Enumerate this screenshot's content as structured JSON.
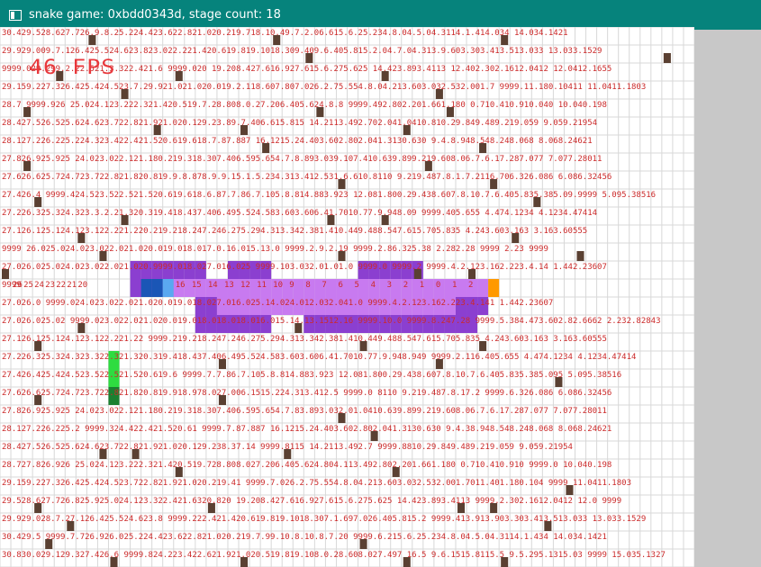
{
  "window": {
    "title": "snake game: 0xbdd0343d, stage count: 18",
    "icon": "window-app-icon"
  },
  "overlay": {
    "fps": "46 FPS"
  },
  "colors": {
    "background": "#ffffff",
    "grid": "#d8d8d8",
    "number_text": "#cc2a2a",
    "obstacle": "#5a4032",
    "path_dark": "#8b3fd0",
    "path_light": "#c87af0",
    "snake_head": "#ff9900",
    "snake_body": "#1a56b6",
    "food_bright": "#2edc40",
    "food_dark": "#1a8030"
  },
  "board": {
    "cols": 64,
    "rows": 30,
    "snake_row": 14,
    "snake_row_numbers": [
      "9999",
      "26",
      "25",
      "24",
      "23",
      "22",
      "21",
      "20",
      "",
      "",
      "",
      "",
      "",
      "",
      "",
      "",
      "",
      "",
      "",
      "",
      "",
      "",
      "",
      "",
      "",
      "",
      "",
      "",
      "",
      "",
      "",
      "",
      "",
      "",
      "",
      "",
      "",
      "",
      "",
      "",
      "",
      "",
      "",
      "",
      "",
      "",
      "",
      "",
      "",
      "",
      "",
      "",
      "",
      "",
      "",
      "",
      "",
      "",
      "",
      "",
      "",
      "",
      "",
      ""
    ],
    "snake_path_labels": [
      "16",
      "15",
      "14",
      "13",
      "12",
      "11",
      "10",
      "9",
      "8",
      "7",
      "6",
      "5",
      "4",
      "3",
      "2",
      "1",
      "0",
      "1",
      "2"
    ],
    "row_text": [
      "30.429.528.627.726.9.8.25.224.423.622.821.020.219.718.10.49.7.2.06.615.6.25.234.8.04.5.04.3114.1.414.034 14.034.1421",
      "29.929.009.7.126.425.524.623.823.022.221.420.619.819.1018.309.409.6.405.815.2.04.7.04.313.9.603.303.413.513.033 13.033.1529",
      "9999.029.299.2.22.521.3.322.421.6 9999.020 19.208.427.616.927.615.6.275.625 14.423.893.4113 12.402.302.1612.0412 12.0412.1655",
      "29.159.227.326.425.424.523.7.29.921.021.020.019.2.118.607.807.026.2.75.554.8.04.213.603.032.532.001.7 9999.11.180.10411 11.0411.1803",
      "28.7 9999.926 25.024.123.222.321.420.519.7.28.808.0.27.206.405.624.8.8 9999.492.802.201.661.180 0.710.410.910.040 10.040.198",
      "28.427.526.525.624.623.722.821.921.020.129.23.89.7.406.615.815 14.2113.492.702.041.0410.810.29.849.489.219.059 9.059.21954",
      "28.127.226.225.224.323.422.421.520.619.618.7.87.887 16.1215.24.403.602.802.041.3130.630 9.4.8.948.548.248.068 8.068.24621",
      "27.826.925.925 24.023.022.121.180.219.318.307.406.595.654.7.8.893.039.107.410.639.899.219.608.06.7.6.17.287.077 7.077.28011",
      "27.626.625.724.723.722.821.820.819.9.8.878.9.9.15.1.5.234.313.412.531.6.610.8110 9.219.487.8.1.7.2116.706.326.086 6.086.32456",
      "27.426.4 9999.424.523.522.521.520.619.618.6.87.7.86.7.105.8.814.883.923 12.081.800.29.438.607.8.10.7.6.405.835.385.09.9999 5.095.38516",
      "27.226.325.324.323.3.2.21.320.319.418.437.406.495.524.583.603.606.41.7010.77.9.948.09 9999.405.655 4.474.1234 4.1234.47414",
      "27.126.125.124.123.122.221.220.219.218.247.246.275.294.313.342.381.410.449.488.547.615.705.835 4.243.603.163 3.163.60555",
      "9999 26.025.024.023.022.021.020.019.018.017.0.16.015.13.0 9999.2.9.2.19 9999.2.86.325.38 2.282.28 9999 2.23 9999",
      "27.026.025.024.023.022.021.020.9999.018.027.016.025 9999.103.032.01.01.0 9999.0 9999.2 9999.4.2.123.162.223.4.14 1.442.23607",
      "",
      "27.026.0 9999.024.023.022.021.020.019.018.027.016.025.14.024.012.032.041.0 9999.4.2.123.162.223.4.141 1.442.23607",
      "27.026.025.02 9999.023.022.021.020.019.018.018.018.016.015.14.13.1512.16 9999.10.0 9999.8.247.28 9999.5.384.473.602.82.6662 2.232.82843",
      "27.126.125.124.123.122.221.22 9999.219.218.247.246.275.294.313.342.381.410.449.488.547.615.705.835 4.243.603.163 3.163.60555",
      "27.226.325.324.323.322.321.320.319.418.437.406.495.524.583.603.606.41.7010.77.9.948.949 9999.2.116.405.655 4.474.1234 4.1234.47414",
      "27.426.425.424.523.522.521.520.619.6 9999.7.7.86.7.105.8.814.883.923 12.081.800.29.438.607.8.10.7.6.405.835.385.095 5.095.38516",
      "27.626.625.724.723.722.821.820.819.918.978.027.006.1515.224.313.412.5 9999.0 8110 9.219.487.8.17.2 9999.6.326.086 6.086.32456",
      "27.826.925.925 24.023.022.121.180.219.318.307.406.595.654.7.83.893.032.01.0410.639.899.219.608.06.7.6.17.287.077 7.077.28011",
      "28.127.226.225.2 9999.324.422.421.520.61 9999.7.87.887 16.1215.24.403.602.802.041.3130.630 9.4.38.948.548.248.068 8.068.24621",
      "28.427.526.525.624.623.722.821.921.020.129.238.37.14 9999.8115 14.2113.492.7 9999.8810.29.849.489.219.059 9.059.21954",
      "28.727.826.926 25.024.123.222.321.420.519.728.808.027.206.405.624.804.113.492.802.201.661.180 0.710.410.910 9999.0 10.040.198",
      "29.159.227.326.425.424.523.722.821.921.020.219.41 9999.7.026.2.75.554.8.04.213.603.032.532.001.7011.401.180.104 9999 11.0411.1803",
      "29.528.627.726.825.925.024.123.322.421.6320.820 19.208.427.616.927.615.6.275.625 14.423.893.4113 9999.2.302.1612.0412 12.0 9999",
      "29.929.028.7.27.126.425.524.623.8 9999.222.421.420.619.819.1018.307.1.697.026.405.815.2 9999.413.913.903.303.413.513.033 13.033.1529",
      "30.429.5 9999.7.726.926.025.224.423.622.821.020.219.7.99.10.8.10.8.7.20 9999.6.215.6.25.234.8.04.5.04.3114.1.434 14.034.1421",
      "30.830.029.129.327.426.6 9999.824.223.422.621.921.020.519.819.108.0.28.608.027.497 16.5 9.6.1515.8115.5 9.5.295.1315.03 9999 15.035.1327"
    ]
  }
}
